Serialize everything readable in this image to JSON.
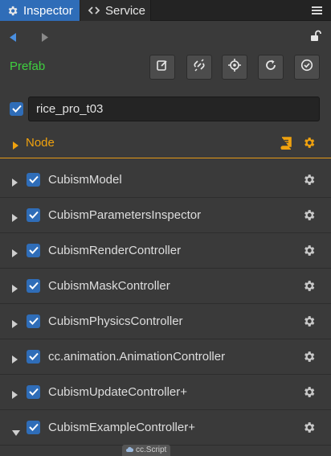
{
  "tabs": [
    {
      "label": "Inspector",
      "icon": "gear-icon",
      "active": true
    },
    {
      "label": "Service",
      "icon": "link-icon",
      "active": false
    }
  ],
  "prefab": {
    "label": "Prefab",
    "label_color": "#3fcf3f",
    "buttons": [
      "edit-icon",
      "unlink-icon",
      "locate-icon",
      "refresh-icon",
      "apply-icon"
    ]
  },
  "node_name": {
    "checked": true,
    "value": "rice_pro_t03"
  },
  "node_section": {
    "label": "Node",
    "accent": "#f0a20e"
  },
  "components": [
    {
      "label": "CubismModel",
      "expanded": false,
      "checked": true
    },
    {
      "label": "CubismParametersInspector",
      "expanded": false,
      "checked": true
    },
    {
      "label": "CubismRenderController",
      "expanded": false,
      "checked": true
    },
    {
      "label": "CubismMaskController",
      "expanded": false,
      "checked": true
    },
    {
      "label": "CubismPhysicsController",
      "expanded": false,
      "checked": true
    },
    {
      "label": "cc.animation.AnimationController",
      "expanded": false,
      "checked": true
    },
    {
      "label": "CubismUpdateController+",
      "expanded": false,
      "checked": true
    },
    {
      "label": "CubismExampleController+",
      "expanded": true,
      "checked": true
    }
  ],
  "script_chip": {
    "label": "cc.Script"
  },
  "colors": {
    "accent_blue": "#2f6db8",
    "background": "#3a3a3a"
  }
}
